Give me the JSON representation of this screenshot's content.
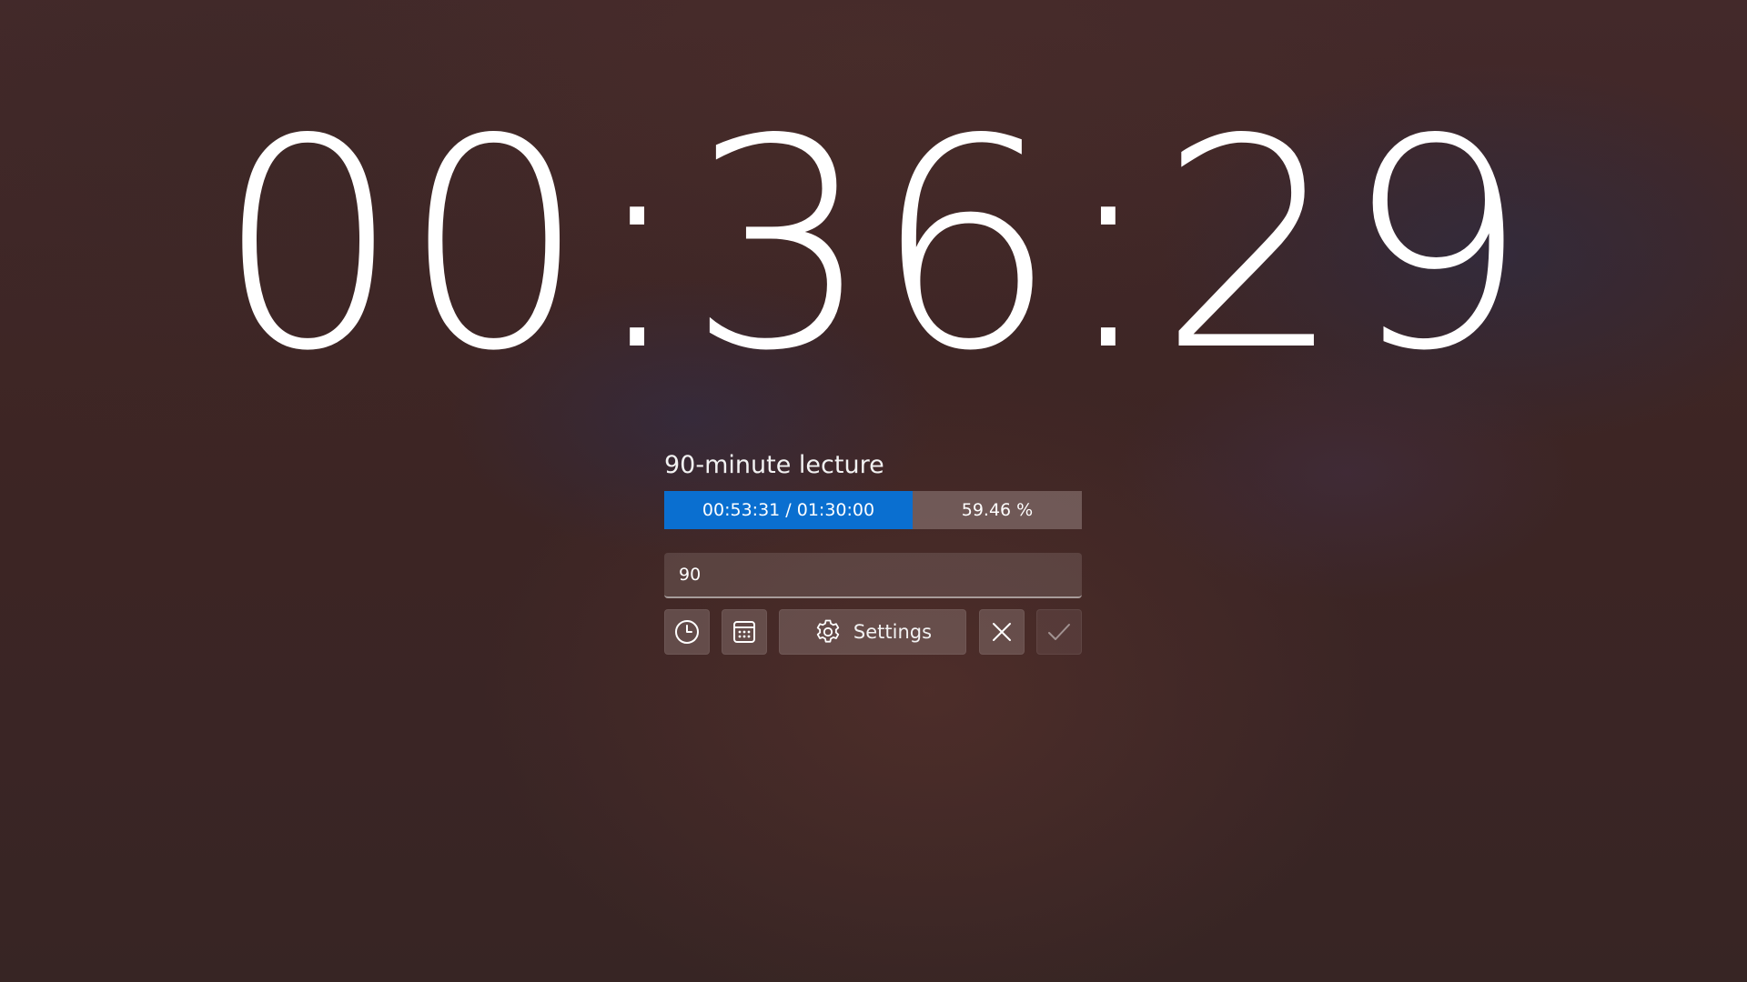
{
  "clock": {
    "remaining": "00:36:29"
  },
  "timer": {
    "title": "90-minute lecture",
    "progress_text": "00:53:31 / 01:30:00",
    "percent_text": "59.46 %",
    "progress_fraction": 0.5946,
    "accent_color": "#0a6fd0"
  },
  "input": {
    "value": "90"
  },
  "toolbar": {
    "clock_icon": "clock-icon",
    "calendar_icon": "calendar-icon",
    "settings_icon": "gear-icon",
    "settings_label": "Settings",
    "cancel_icon": "close-icon",
    "confirm_icon": "checkmark-icon"
  }
}
